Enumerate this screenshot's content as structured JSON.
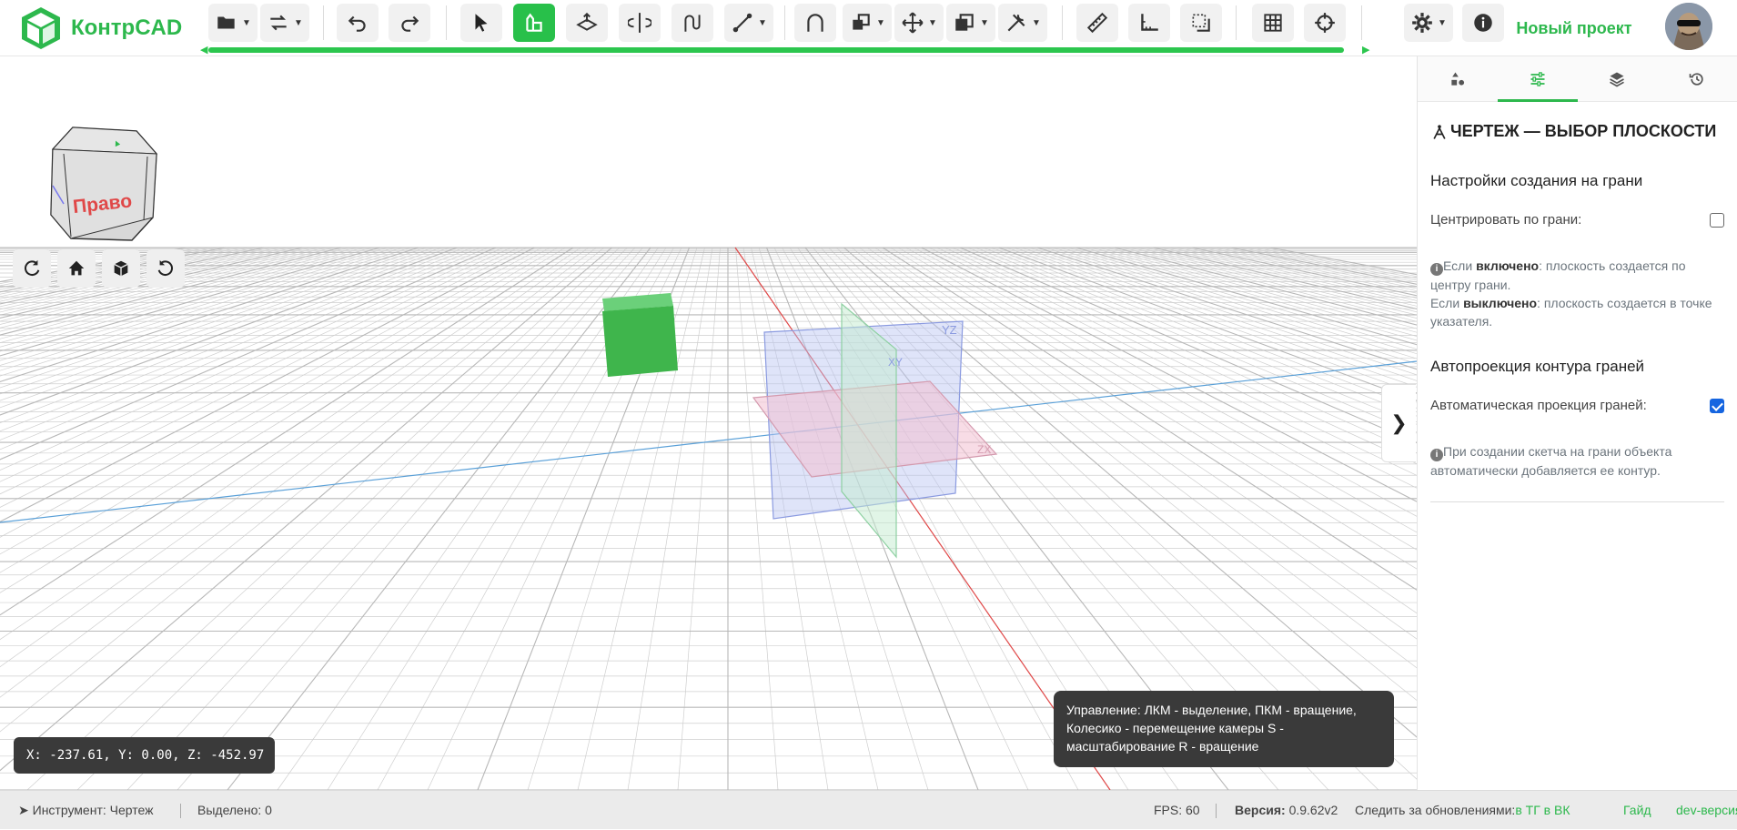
{
  "app": {
    "name": "КонтрCAD",
    "project": "Новый проект"
  },
  "toolbar": {
    "icons": [
      "folder-icon",
      "swap-icon",
      "undo-icon",
      "redo-icon",
      "pointer-icon",
      "sketch-icon",
      "extrude-icon",
      "revolve-icon",
      "sweep-icon",
      "line-icon",
      "fillet-icon",
      "boolean-icon",
      "move-icon",
      "pattern-icon",
      "tools-icon",
      "ruler-icon",
      "corner-icon",
      "frame-icon",
      "grid-icon",
      "target-icon",
      "gear-icon",
      "info-icon"
    ],
    "active": "sketch-icon"
  },
  "viewcube": {
    "label": "Право"
  },
  "view_buttons": [
    "refresh-icon",
    "home-icon",
    "cube-view-icon",
    "reset-view-icon"
  ],
  "coords": {
    "text": "X: -237.61, Y: 0.00, Z: -452.97"
  },
  "help": {
    "text": "Управление: ЛКМ - выделение, ПКМ - вращение, Колесико - перемещение камеры S - масштабирование R - вращение"
  },
  "scene": {
    "plane_labels": [
      "YZ",
      "XY",
      "ZX"
    ]
  },
  "panel": {
    "tabs": [
      "shapes-icon",
      "sliders-icon",
      "layers-icon",
      "history-icon"
    ],
    "active_tab": 1,
    "title": "ЧЕРТЕЖ — ВЫБОР ПЛОСКОСТИ",
    "section1": {
      "heading": "Настройки создания на грани",
      "option_label": "Центрировать по грани:",
      "checked": false,
      "note_prefix": "Если ",
      "note_on_bold": "включено",
      "note_on_text": ": плоскость создается по центру грани.",
      "note_prefix2": "Если ",
      "note_off_bold": "выключено",
      "note_off_text": ": плоскость создается в точке указателя."
    },
    "section2": {
      "heading": "Автопроекция контура граней",
      "option_label": "Автоматическая проекция граней:",
      "checked": true,
      "note": "При создании скетча на грани объекта автоматически добавляется ее контур."
    }
  },
  "status": {
    "tool_label": "Инструмент: Чертеж",
    "selected": "Выделено: 0",
    "fps": "FPS: 60",
    "version_label": "Версия:",
    "version": "0.9.62v2",
    "follow": "Следить за обновлениями:",
    "follow_links": "в ТГ в ВК",
    "guide": "Гайд",
    "dev": "dev-версия"
  },
  "colors": {
    "accent": "#2db84d",
    "active_tool": "#28c04a",
    "progress": "#2cc64e",
    "axis_red": "#e04848",
    "axis_blue": "#5aa0d8",
    "cube": "#3fb54c",
    "checkbox": "#1565e0"
  }
}
